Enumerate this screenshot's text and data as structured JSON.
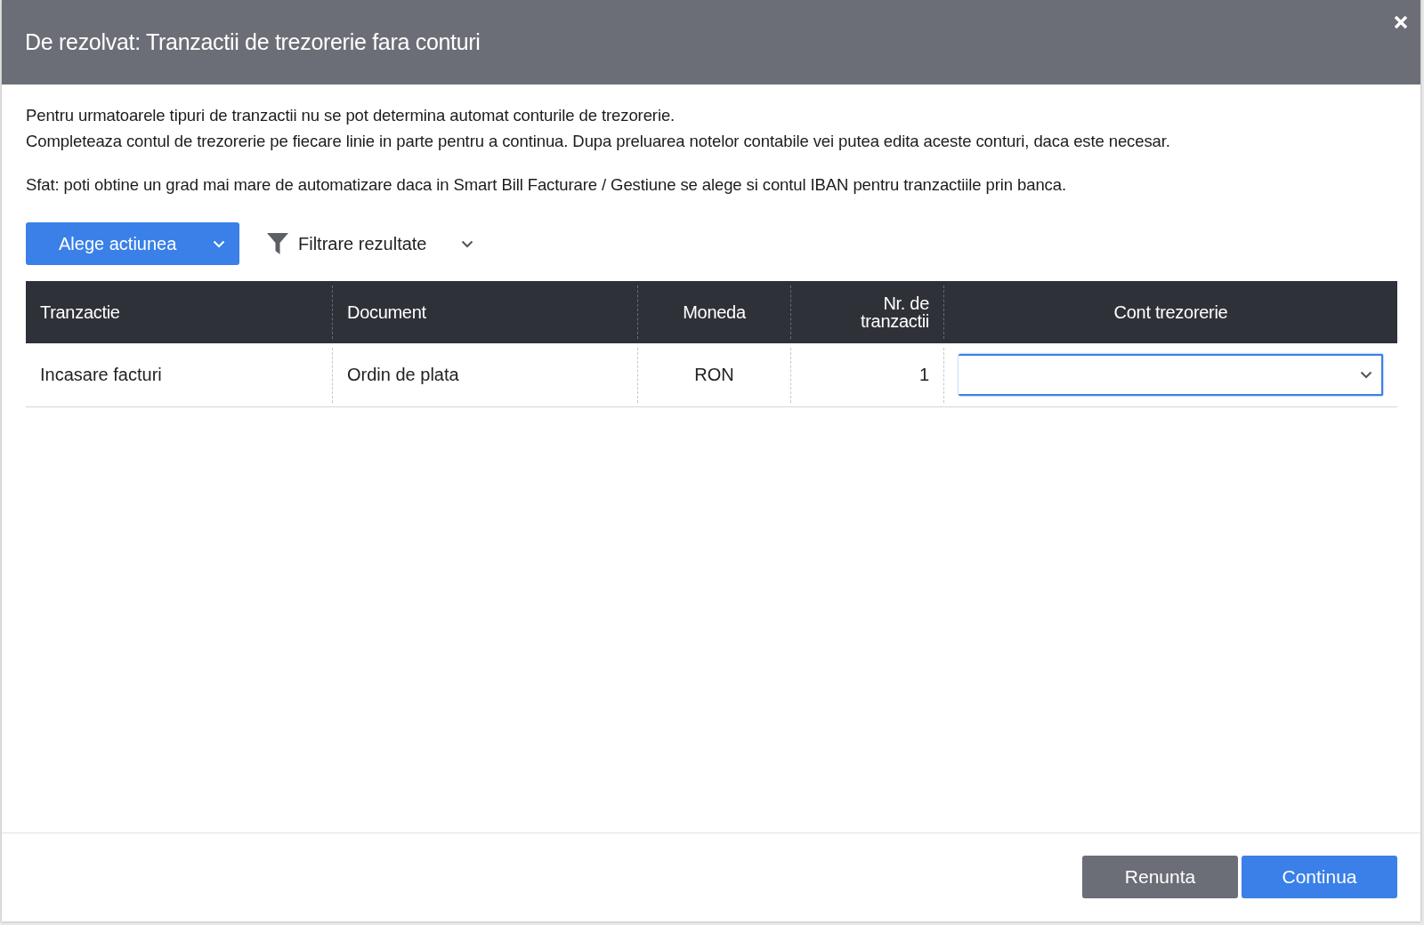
{
  "dialog": {
    "title": "De rezolvat: Tranzactii de trezorerie fara conturi"
  },
  "intro": [
    "Pentru urmatoarele tipuri de tranzactii nu se pot determina automat conturile de trezorerie.",
    "Completeaza contul de trezorerie pe fiecare linie in parte pentru a continua. Dupa preluarea notelor contabile vei putea edita aceste conturi, daca este necesar."
  ],
  "tip": "Sfat: poti obtine un grad mai mare de automatizare daca in Smart Bill Facturare / Gestiune se alege si contul IBAN pentru tranzactiile prin banca.",
  "toolbar": {
    "action_button": "Alege actiunea",
    "filter": "Filtrare rezultate"
  },
  "table": {
    "columns": [
      "Tranzactie",
      "Document",
      "Moneda",
      "Nr. de tranzactii",
      "Cont trezorerie"
    ],
    "rows": [
      {
        "cells": [
          "Incasare facturi",
          "Ordin de plata",
          "RON",
          "1"
        ],
        "account_select": {
          "focused": true
        }
      }
    ]
  },
  "footer": {
    "buttons": [
      {
        "label": "Renunta",
        "kind": "secondary"
      },
      {
        "label": "Continua",
        "kind": "primary"
      }
    ]
  }
}
